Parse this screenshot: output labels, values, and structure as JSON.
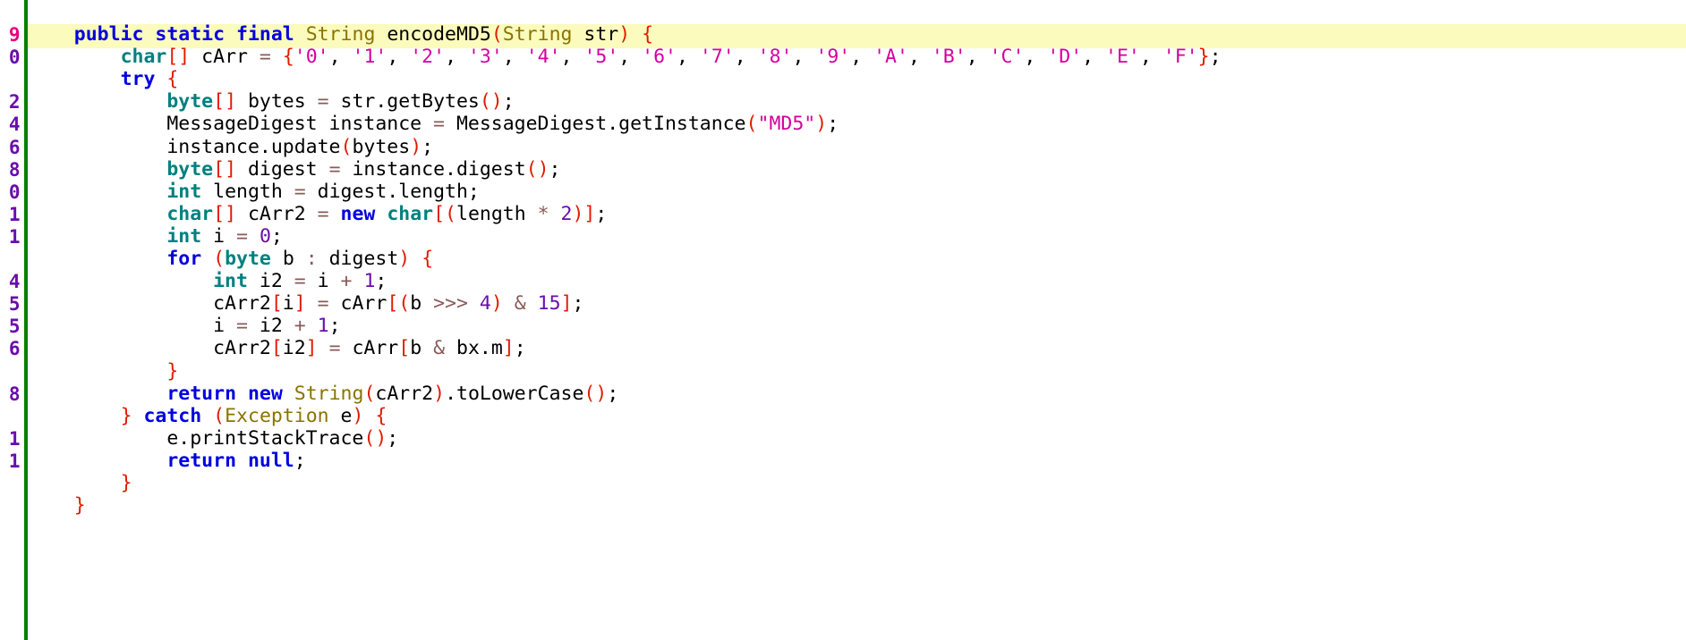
{
  "editor": {
    "language": "java",
    "current_line_highlight_color": "#fbfbbd",
    "fold_bar_color": "#008000",
    "gutter_number_color": "#6a0dad",
    "current_gutter_number_color": "#e6007e",
    "background_color": "#ffffff"
  },
  "gutter": {
    "visible_digits": [
      "9",
      "0",
      "",
      "2",
      "4",
      "6",
      "8",
      "0",
      "1",
      "1",
      "",
      "4",
      "5",
      "5",
      "6",
      "",
      "8",
      "",
      "1",
      "1",
      "",
      ""
    ],
    "current_line_index": 0
  },
  "code": {
    "lines": [
      {
        "indent": "    ",
        "text": "public static final String encodeMD5(String str) {",
        "highlighted": true,
        "tokens": [
          {
            "t": "    ",
            "c": "id"
          },
          {
            "t": "public",
            "c": "kw"
          },
          {
            "t": " ",
            "c": "id"
          },
          {
            "t": "static",
            "c": "kw"
          },
          {
            "t": " ",
            "c": "id"
          },
          {
            "t": "final",
            "c": "kw"
          },
          {
            "t": " ",
            "c": "id"
          },
          {
            "t": "String",
            "c": "cls"
          },
          {
            "t": " encodeMD5",
            "c": "id"
          },
          {
            "t": "(",
            "c": "br"
          },
          {
            "t": "String",
            "c": "cls"
          },
          {
            "t": " str",
            "c": "id"
          },
          {
            "t": ")",
            "c": "br"
          },
          {
            "t": " ",
            "c": "id"
          },
          {
            "t": "{",
            "c": "br"
          }
        ]
      },
      {
        "indent": "        ",
        "text": "char[] cArr = {'0', '1', '2', '3', '4', '5', '6', '7', '8', '9', 'A', 'B', 'C', 'D', 'E', 'F'};",
        "highlighted": false,
        "tokens": [
          {
            "t": "        ",
            "c": "id"
          },
          {
            "t": "char",
            "c": "prim"
          },
          {
            "t": "[]",
            "c": "br"
          },
          {
            "t": " cArr ",
            "c": "id"
          },
          {
            "t": "=",
            "c": "op"
          },
          {
            "t": " ",
            "c": "id"
          },
          {
            "t": "{",
            "c": "br"
          },
          {
            "t": "'0'",
            "c": "lit"
          },
          {
            "t": ", ",
            "c": "id"
          },
          {
            "t": "'1'",
            "c": "lit"
          },
          {
            "t": ", ",
            "c": "id"
          },
          {
            "t": "'2'",
            "c": "lit"
          },
          {
            "t": ", ",
            "c": "id"
          },
          {
            "t": "'3'",
            "c": "lit"
          },
          {
            "t": ", ",
            "c": "id"
          },
          {
            "t": "'4'",
            "c": "lit"
          },
          {
            "t": ", ",
            "c": "id"
          },
          {
            "t": "'5'",
            "c": "lit"
          },
          {
            "t": ", ",
            "c": "id"
          },
          {
            "t": "'6'",
            "c": "lit"
          },
          {
            "t": ", ",
            "c": "id"
          },
          {
            "t": "'7'",
            "c": "lit"
          },
          {
            "t": ", ",
            "c": "id"
          },
          {
            "t": "'8'",
            "c": "lit"
          },
          {
            "t": ", ",
            "c": "id"
          },
          {
            "t": "'9'",
            "c": "lit"
          },
          {
            "t": ", ",
            "c": "id"
          },
          {
            "t": "'A'",
            "c": "lit"
          },
          {
            "t": ", ",
            "c": "id"
          },
          {
            "t": "'B'",
            "c": "lit"
          },
          {
            "t": ", ",
            "c": "id"
          },
          {
            "t": "'C'",
            "c": "lit"
          },
          {
            "t": ", ",
            "c": "id"
          },
          {
            "t": "'D'",
            "c": "lit"
          },
          {
            "t": ", ",
            "c": "id"
          },
          {
            "t": "'E'",
            "c": "lit"
          },
          {
            "t": ", ",
            "c": "id"
          },
          {
            "t": "'F'",
            "c": "lit"
          },
          {
            "t": "}",
            "c": "br"
          },
          {
            "t": ";",
            "c": "id"
          }
        ]
      },
      {
        "indent": "        ",
        "text": "try {",
        "highlighted": false,
        "tokens": [
          {
            "t": "        ",
            "c": "id"
          },
          {
            "t": "try",
            "c": "kw"
          },
          {
            "t": " ",
            "c": "id"
          },
          {
            "t": "{",
            "c": "br"
          }
        ]
      },
      {
        "indent": "            ",
        "text": "byte[] bytes = str.getBytes();",
        "highlighted": false,
        "tokens": [
          {
            "t": "            ",
            "c": "id"
          },
          {
            "t": "byte",
            "c": "prim"
          },
          {
            "t": "[]",
            "c": "br"
          },
          {
            "t": " bytes ",
            "c": "id"
          },
          {
            "t": "=",
            "c": "op"
          },
          {
            "t": " str.getBytes",
            "c": "id"
          },
          {
            "t": "()",
            "c": "br"
          },
          {
            "t": ";",
            "c": "id"
          }
        ]
      },
      {
        "indent": "            ",
        "text": "MessageDigest instance = MessageDigest.getInstance(\"MD5\");",
        "highlighted": false,
        "tokens": [
          {
            "t": "            MessageDigest instance ",
            "c": "id"
          },
          {
            "t": "=",
            "c": "op"
          },
          {
            "t": " MessageDigest.getInstance",
            "c": "id"
          },
          {
            "t": "(",
            "c": "br"
          },
          {
            "t": "\"MD5\"",
            "c": "lit"
          },
          {
            "t": ")",
            "c": "br"
          },
          {
            "t": ";",
            "c": "id"
          }
        ]
      },
      {
        "indent": "            ",
        "text": "instance.update(bytes);",
        "highlighted": false,
        "tokens": [
          {
            "t": "            instance.update",
            "c": "id"
          },
          {
            "t": "(",
            "c": "br"
          },
          {
            "t": "bytes",
            "c": "id"
          },
          {
            "t": ")",
            "c": "br"
          },
          {
            "t": ";",
            "c": "id"
          }
        ]
      },
      {
        "indent": "            ",
        "text": "byte[] digest = instance.digest();",
        "highlighted": false,
        "tokens": [
          {
            "t": "            ",
            "c": "id"
          },
          {
            "t": "byte",
            "c": "prim"
          },
          {
            "t": "[]",
            "c": "br"
          },
          {
            "t": " digest ",
            "c": "id"
          },
          {
            "t": "=",
            "c": "op"
          },
          {
            "t": " instance.digest",
            "c": "id"
          },
          {
            "t": "()",
            "c": "br"
          },
          {
            "t": ";",
            "c": "id"
          }
        ]
      },
      {
        "indent": "            ",
        "text": "int length = digest.length;",
        "highlighted": false,
        "tokens": [
          {
            "t": "            ",
            "c": "id"
          },
          {
            "t": "int",
            "c": "prim"
          },
          {
            "t": " length ",
            "c": "id"
          },
          {
            "t": "=",
            "c": "op"
          },
          {
            "t": " digest.length;",
            "c": "id"
          }
        ]
      },
      {
        "indent": "            ",
        "text": "char[] cArr2 = new char[(length * 2)];",
        "highlighted": false,
        "tokens": [
          {
            "t": "            ",
            "c": "id"
          },
          {
            "t": "char",
            "c": "prim"
          },
          {
            "t": "[]",
            "c": "br"
          },
          {
            "t": " cArr2 ",
            "c": "id"
          },
          {
            "t": "=",
            "c": "op"
          },
          {
            "t": " ",
            "c": "id"
          },
          {
            "t": "new",
            "c": "kw"
          },
          {
            "t": " ",
            "c": "id"
          },
          {
            "t": "char",
            "c": "prim"
          },
          {
            "t": "[(",
            "c": "br"
          },
          {
            "t": "length ",
            "c": "id"
          },
          {
            "t": "*",
            "c": "op"
          },
          {
            "t": " ",
            "c": "id"
          },
          {
            "t": "2",
            "c": "num"
          },
          {
            "t": ")]",
            "c": "br"
          },
          {
            "t": ";",
            "c": "id"
          }
        ]
      },
      {
        "indent": "            ",
        "text": "int i = 0;",
        "highlighted": false,
        "tokens": [
          {
            "t": "            ",
            "c": "id"
          },
          {
            "t": "int",
            "c": "prim"
          },
          {
            "t": " i ",
            "c": "id"
          },
          {
            "t": "=",
            "c": "op"
          },
          {
            "t": " ",
            "c": "id"
          },
          {
            "t": "0",
            "c": "num"
          },
          {
            "t": ";",
            "c": "id"
          }
        ]
      },
      {
        "indent": "            ",
        "text": "for (byte b : digest) {",
        "highlighted": false,
        "tokens": [
          {
            "t": "            ",
            "c": "id"
          },
          {
            "t": "for",
            "c": "kw"
          },
          {
            "t": " ",
            "c": "id"
          },
          {
            "t": "(",
            "c": "br"
          },
          {
            "t": "byte",
            "c": "prim"
          },
          {
            "t": " b ",
            "c": "id"
          },
          {
            "t": ":",
            "c": "op"
          },
          {
            "t": " digest",
            "c": "id"
          },
          {
            "t": ")",
            "c": "br"
          },
          {
            "t": " ",
            "c": "id"
          },
          {
            "t": "{",
            "c": "br"
          }
        ]
      },
      {
        "indent": "                ",
        "text": "int i2 = i + 1;",
        "highlighted": false,
        "tokens": [
          {
            "t": "                ",
            "c": "id"
          },
          {
            "t": "int",
            "c": "prim"
          },
          {
            "t": " i2 ",
            "c": "id"
          },
          {
            "t": "=",
            "c": "op"
          },
          {
            "t": " i ",
            "c": "id"
          },
          {
            "t": "+",
            "c": "op"
          },
          {
            "t": " ",
            "c": "id"
          },
          {
            "t": "1",
            "c": "num"
          },
          {
            "t": ";",
            "c": "id"
          }
        ]
      },
      {
        "indent": "                ",
        "text": "cArr2[i] = cArr[(b >>> 4) & 15];",
        "highlighted": false,
        "tokens": [
          {
            "t": "                cArr2",
            "c": "id"
          },
          {
            "t": "[",
            "c": "br"
          },
          {
            "t": "i",
            "c": "id"
          },
          {
            "t": "]",
            "c": "br"
          },
          {
            "t": " ",
            "c": "id"
          },
          {
            "t": "=",
            "c": "op"
          },
          {
            "t": " cArr",
            "c": "id"
          },
          {
            "t": "[(",
            "c": "br"
          },
          {
            "t": "b ",
            "c": "id"
          },
          {
            "t": ">>>",
            "c": "op"
          },
          {
            "t": " ",
            "c": "id"
          },
          {
            "t": "4",
            "c": "num"
          },
          {
            "t": ")",
            "c": "br"
          },
          {
            "t": " ",
            "c": "id"
          },
          {
            "t": "&",
            "c": "op"
          },
          {
            "t": " ",
            "c": "id"
          },
          {
            "t": "15",
            "c": "num"
          },
          {
            "t": "]",
            "c": "br"
          },
          {
            "t": ";",
            "c": "id"
          }
        ]
      },
      {
        "indent": "                ",
        "text": "i = i2 + 1;",
        "highlighted": false,
        "tokens": [
          {
            "t": "                i ",
            "c": "id"
          },
          {
            "t": "=",
            "c": "op"
          },
          {
            "t": " i2 ",
            "c": "id"
          },
          {
            "t": "+",
            "c": "op"
          },
          {
            "t": " ",
            "c": "id"
          },
          {
            "t": "1",
            "c": "num"
          },
          {
            "t": ";",
            "c": "id"
          }
        ]
      },
      {
        "indent": "                ",
        "text": "cArr2[i2] = cArr[b & bx.m];",
        "highlighted": false,
        "tokens": [
          {
            "t": "                cArr2",
            "c": "id"
          },
          {
            "t": "[",
            "c": "br"
          },
          {
            "t": "i2",
            "c": "id"
          },
          {
            "t": "]",
            "c": "br"
          },
          {
            "t": " ",
            "c": "id"
          },
          {
            "t": "=",
            "c": "op"
          },
          {
            "t": " cArr",
            "c": "id"
          },
          {
            "t": "[",
            "c": "br"
          },
          {
            "t": "b ",
            "c": "id"
          },
          {
            "t": "&",
            "c": "op"
          },
          {
            "t": " bx.m",
            "c": "id"
          },
          {
            "t": "]",
            "c": "br"
          },
          {
            "t": ";",
            "c": "id"
          }
        ]
      },
      {
        "indent": "            ",
        "text": "}",
        "highlighted": false,
        "tokens": [
          {
            "t": "            ",
            "c": "id"
          },
          {
            "t": "}",
            "c": "br"
          }
        ]
      },
      {
        "indent": "            ",
        "text": "return new String(cArr2).toLowerCase();",
        "highlighted": false,
        "tokens": [
          {
            "t": "            ",
            "c": "id"
          },
          {
            "t": "return",
            "c": "kw"
          },
          {
            "t": " ",
            "c": "id"
          },
          {
            "t": "new",
            "c": "kw"
          },
          {
            "t": " ",
            "c": "id"
          },
          {
            "t": "String",
            "c": "cls"
          },
          {
            "t": "(",
            "c": "br"
          },
          {
            "t": "cArr2",
            "c": "id"
          },
          {
            "t": ")",
            "c": "br"
          },
          {
            "t": ".toLowerCase",
            "c": "id"
          },
          {
            "t": "()",
            "c": "br"
          },
          {
            "t": ";",
            "c": "id"
          }
        ]
      },
      {
        "indent": "        ",
        "text": "} catch (Exception e) {",
        "highlighted": false,
        "tokens": [
          {
            "t": "        ",
            "c": "id"
          },
          {
            "t": "}",
            "c": "br"
          },
          {
            "t": " ",
            "c": "id"
          },
          {
            "t": "catch",
            "c": "kw"
          },
          {
            "t": " ",
            "c": "id"
          },
          {
            "t": "(",
            "c": "br"
          },
          {
            "t": "Exception",
            "c": "cls"
          },
          {
            "t": " e",
            "c": "id"
          },
          {
            "t": ")",
            "c": "br"
          },
          {
            "t": " ",
            "c": "id"
          },
          {
            "t": "{",
            "c": "br"
          }
        ]
      },
      {
        "indent": "            ",
        "text": "e.printStackTrace();",
        "highlighted": false,
        "tokens": [
          {
            "t": "            e.printStackTrace",
            "c": "id"
          },
          {
            "t": "()",
            "c": "br"
          },
          {
            "t": ";",
            "c": "id"
          }
        ]
      },
      {
        "indent": "            ",
        "text": "return null;",
        "highlighted": false,
        "tokens": [
          {
            "t": "            ",
            "c": "id"
          },
          {
            "t": "return",
            "c": "kw"
          },
          {
            "t": " ",
            "c": "id"
          },
          {
            "t": "null",
            "c": "kw"
          },
          {
            "t": ";",
            "c": "id"
          }
        ]
      },
      {
        "indent": "        ",
        "text": "}",
        "highlighted": false,
        "tokens": [
          {
            "t": "        ",
            "c": "id"
          },
          {
            "t": "}",
            "c": "br"
          }
        ]
      },
      {
        "indent": "    ",
        "text": "}",
        "highlighted": false,
        "tokens": [
          {
            "t": "    ",
            "c": "id"
          },
          {
            "t": "}",
            "c": "br"
          }
        ]
      }
    ]
  }
}
